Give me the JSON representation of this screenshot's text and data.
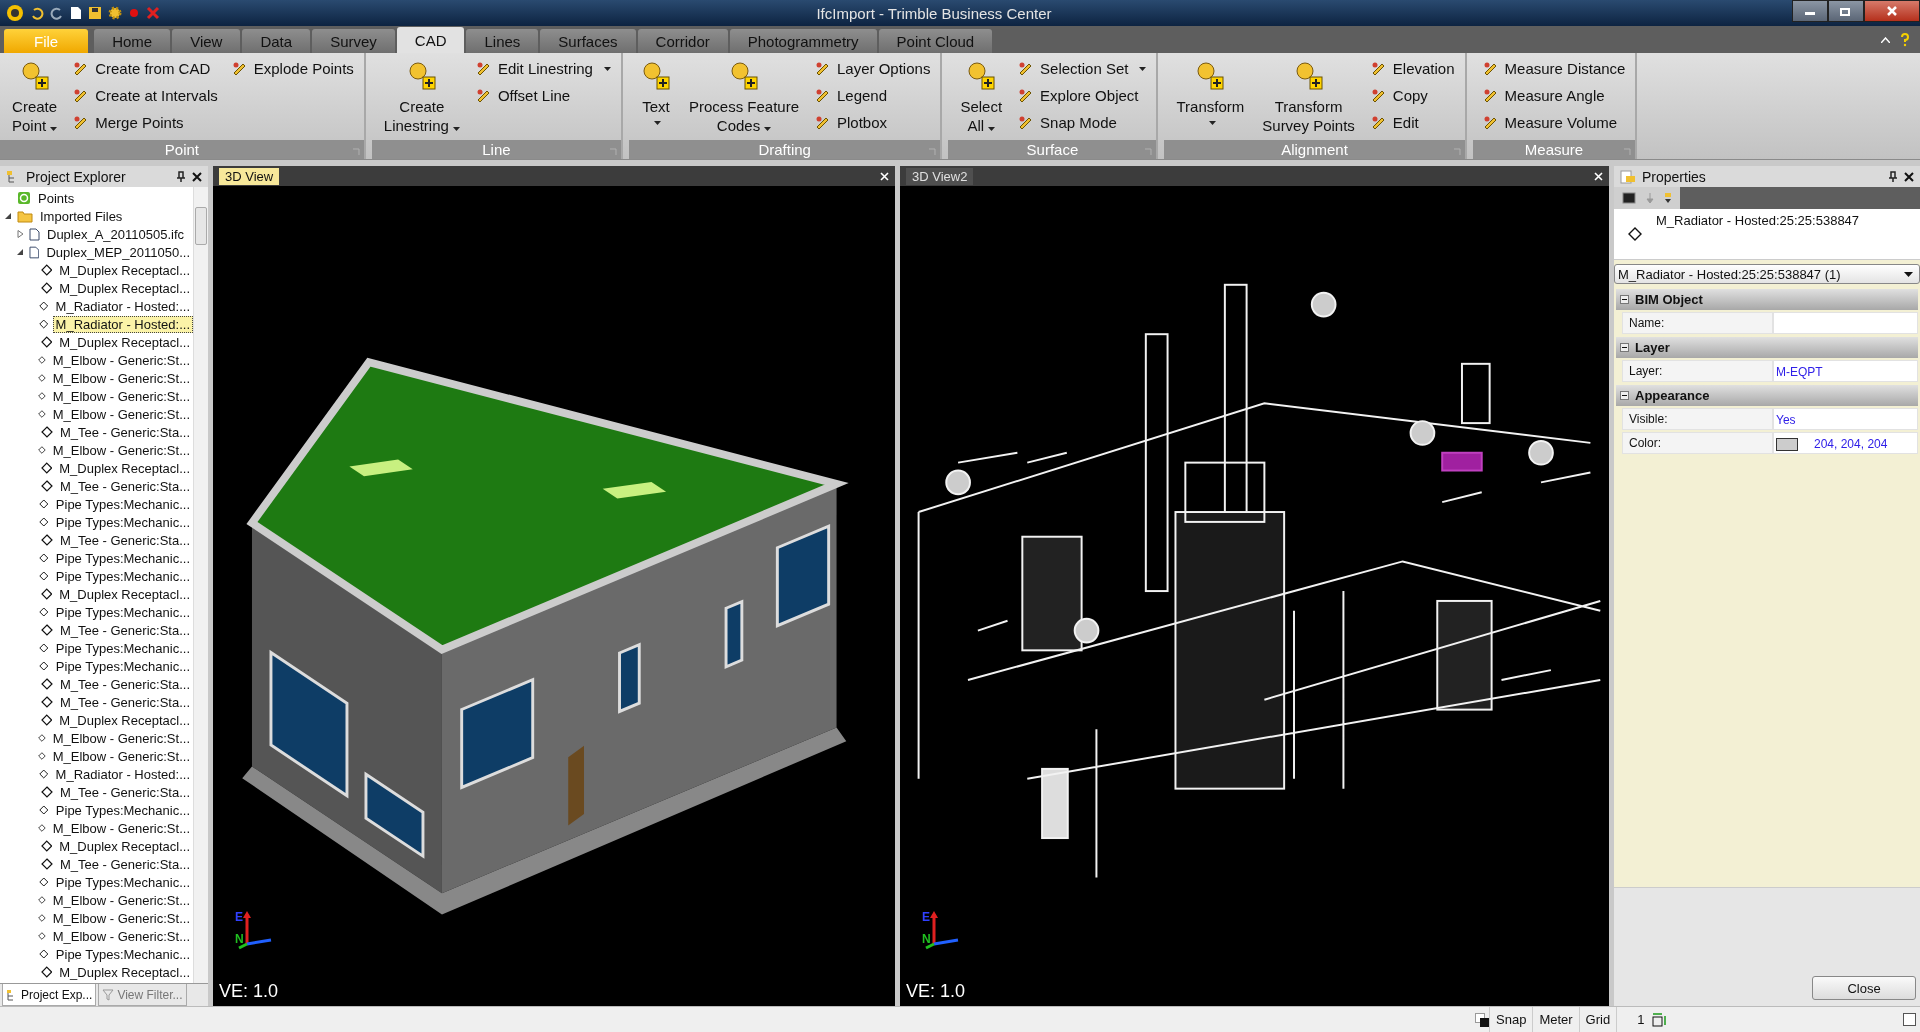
{
  "window": {
    "title": "IfcImport - Trimble Business Center"
  },
  "ribbon_tabs": [
    {
      "label": "File",
      "kind": "application",
      "selected": false
    },
    {
      "label": "Home",
      "kind": "tab",
      "selected": false
    },
    {
      "label": "View",
      "kind": "tab",
      "selected": false
    },
    {
      "label": "Data",
      "kind": "tab",
      "selected": false
    },
    {
      "label": "Survey",
      "kind": "tab",
      "selected": false
    },
    {
      "label": "CAD",
      "kind": "tab",
      "selected": true
    },
    {
      "label": "Lines",
      "kind": "tab",
      "selected": false
    },
    {
      "label": "Surfaces",
      "kind": "tab",
      "selected": false
    },
    {
      "label": "Corridor",
      "kind": "tab",
      "selected": false
    },
    {
      "label": "Photogrammetry",
      "kind": "tab",
      "selected": false
    },
    {
      "label": "Point Cloud",
      "kind": "tab",
      "selected": false
    }
  ],
  "ribbon_groups": [
    {
      "title": "Point",
      "items": [
        {
          "kind": "large",
          "lines": [
            "Create",
            "Point"
          ],
          "dropdown": true
        },
        {
          "kind": "small",
          "label": "Create from CAD",
          "dropdown": false
        },
        {
          "kind": "small",
          "label": "Create at Intervals",
          "dropdown": false
        },
        {
          "kind": "small",
          "label": "Merge Points",
          "dropdown": false
        },
        {
          "kind": "break"
        },
        {
          "kind": "small",
          "label": "Explode Points",
          "dropdown": false
        }
      ]
    },
    {
      "title": "Line",
      "items": [
        {
          "kind": "large",
          "lines": [
            "Create",
            "Linestring"
          ],
          "dropdown": true
        },
        {
          "kind": "small",
          "label": "Edit Linestring",
          "dropdown": true
        },
        {
          "kind": "small",
          "label": "Offset Line",
          "dropdown": false
        }
      ]
    },
    {
      "title": "Drafting",
      "items": [
        {
          "kind": "large",
          "lines": [
            "Text"
          ],
          "dropdown": true
        },
        {
          "kind": "large",
          "lines": [
            "Process Feature",
            "Codes"
          ],
          "dropdown": true
        },
        {
          "kind": "small",
          "label": "Layer Options",
          "dropdown": false
        },
        {
          "kind": "small",
          "label": "Legend",
          "dropdown": false
        },
        {
          "kind": "small",
          "label": "Plotbox",
          "dropdown": false
        }
      ]
    },
    {
      "title": "Surface",
      "items": [
        {
          "kind": "large",
          "lines": [
            "Select",
            "All"
          ],
          "dropdown": true
        },
        {
          "kind": "small",
          "label": "Selection Set",
          "dropdown": true
        },
        {
          "kind": "small",
          "label": "Explore Object",
          "dropdown": false
        },
        {
          "kind": "small",
          "label": "Snap Mode",
          "dropdown": false
        }
      ]
    },
    {
      "title": "Alignment",
      "items": [
        {
          "kind": "large",
          "lines": [
            "Transform"
          ],
          "dropdown": true
        },
        {
          "kind": "large",
          "lines": [
            "Transform",
            "Survey Points"
          ],
          "dropdown": false
        },
        {
          "kind": "small",
          "label": "Elevation",
          "dropdown": false
        },
        {
          "kind": "small",
          "label": "Copy",
          "dropdown": false
        },
        {
          "kind": "small",
          "label": "Edit",
          "dropdown": false
        }
      ]
    },
    {
      "title": "Measure",
      "items": [
        {
          "kind": "small",
          "label": "Measure Distance",
          "dropdown": false
        },
        {
          "kind": "small",
          "label": "Measure Angle",
          "dropdown": false
        },
        {
          "kind": "small",
          "label": "Measure Volume",
          "dropdown": false
        }
      ]
    }
  ],
  "project_explorer": {
    "title": "Project Explorer",
    "tree": [
      {
        "label": "Points",
        "kind": "points",
        "selected": false
      },
      {
        "label": "Imported Files",
        "kind": "folder",
        "selected": false,
        "expanded": true,
        "children": [
          {
            "label": "Duplex_A_20110505.ifc",
            "kind": "file",
            "selected": false,
            "expanded": false
          },
          {
            "label": "Duplex_MEP_2011050...",
            "kind": "file",
            "selected": false,
            "expanded": true,
            "children": [
              {
                "label": "M_Duplex  Receptacl...",
                "kind": "object",
                "selected": false
              },
              {
                "label": "M_Duplex  Receptacl...",
                "kind": "object",
                "selected": false
              },
              {
                "label": "M_Radiator - Hosted:...",
                "kind": "object",
                "selected": false
              },
              {
                "label": "M_Radiator - Hosted:...",
                "kind": "object",
                "selected": true
              },
              {
                "label": "M_Duplex  Receptacl...",
                "kind": "object",
                "selected": false
              },
              {
                "label": "M_Elbow - Generic:St...",
                "kind": "object",
                "selected": false
              },
              {
                "label": "M_Elbow - Generic:St...",
                "kind": "object",
                "selected": false
              },
              {
                "label": "M_Elbow - Generic:St...",
                "kind": "object",
                "selected": false
              },
              {
                "label": "M_Elbow - Generic:St...",
                "kind": "object",
                "selected": false
              },
              {
                "label": "M_Tee - Generic:Sta...",
                "kind": "object",
                "selected": false
              },
              {
                "label": "M_Elbow - Generic:St...",
                "kind": "object",
                "selected": false
              },
              {
                "label": "M_Duplex  Receptacl...",
                "kind": "object",
                "selected": false
              },
              {
                "label": "M_Tee - Generic:Sta...",
                "kind": "object",
                "selected": false
              },
              {
                "label": "Pipe Types:Mechanic...",
                "kind": "object",
                "selected": false
              },
              {
                "label": "Pipe Types:Mechanic...",
                "kind": "object",
                "selected": false
              },
              {
                "label": "M_Tee - Generic:Sta...",
                "kind": "object",
                "selected": false
              },
              {
                "label": "Pipe Types:Mechanic...",
                "kind": "object",
                "selected": false
              },
              {
                "label": "Pipe Types:Mechanic...",
                "kind": "object",
                "selected": false
              },
              {
                "label": "M_Duplex  Receptacl...",
                "kind": "object",
                "selected": false
              },
              {
                "label": "Pipe Types:Mechanic...",
                "kind": "object",
                "selected": false
              },
              {
                "label": "M_Tee - Generic:Sta...",
                "kind": "object",
                "selected": false
              },
              {
                "label": "Pipe Types:Mechanic...",
                "kind": "object",
                "selected": false
              },
              {
                "label": "Pipe Types:Mechanic...",
                "kind": "object",
                "selected": false
              },
              {
                "label": "M_Tee - Generic:Sta...",
                "kind": "object",
                "selected": false
              },
              {
                "label": "M_Tee - Generic:Sta...",
                "kind": "object",
                "selected": false
              },
              {
                "label": "M_Duplex  Receptacl...",
                "kind": "object",
                "selected": false
              },
              {
                "label": "M_Elbow - Generic:St...",
                "kind": "object",
                "selected": false
              },
              {
                "label": "M_Elbow - Generic:St...",
                "kind": "object",
                "selected": false
              },
              {
                "label": "M_Radiator - Hosted:...",
                "kind": "object",
                "selected": false
              },
              {
                "label": "M_Tee - Generic:Sta...",
                "kind": "object",
                "selected": false
              },
              {
                "label": "Pipe Types:Mechanic...",
                "kind": "object",
                "selected": false
              },
              {
                "label": "M_Elbow - Generic:St...",
                "kind": "object",
                "selected": false
              },
              {
                "label": "M_Duplex  Receptacl...",
                "kind": "object",
                "selected": false
              },
              {
                "label": "M_Tee - Generic:Sta...",
                "kind": "object",
                "selected": false
              },
              {
                "label": "Pipe Types:Mechanic...",
                "kind": "object",
                "selected": false
              },
              {
                "label": "M_Elbow - Generic:St...",
                "kind": "object",
                "selected": false
              },
              {
                "label": "M_Elbow - Generic:St...",
                "kind": "object",
                "selected": false
              },
              {
                "label": "M_Elbow - Generic:St...",
                "kind": "object",
                "selected": false
              },
              {
                "label": "Pipe Types:Mechanic...",
                "kind": "object",
                "selected": false
              },
              {
                "label": "M_Duplex  Receptacl...",
                "kind": "object",
                "selected": false
              }
            ]
          }
        ]
      }
    ],
    "bottom_tabs": [
      {
        "label": "Project Exp...",
        "selected": true
      },
      {
        "label": "View Filter...",
        "selected": false
      }
    ]
  },
  "views": [
    {
      "tab": "3D View",
      "selected": true,
      "kind": "building",
      "axis_labels": [
        "E",
        "N"
      ],
      "scale": "VE: 1.0"
    },
    {
      "tab": "3D View2",
      "selected": false,
      "kind": "mep",
      "axis_labels": [
        "E",
        "N"
      ],
      "scale": "VE: 1.0"
    }
  ],
  "properties": {
    "title": "Properties",
    "object_name": "M_Radiator - Hosted:25:25:538847",
    "selector": "M_Radiator - Hosted:25:25:538847 (1)",
    "sections": [
      {
        "title": "BIM Object",
        "expanded": true,
        "rows": [
          {
            "label": "Name:"
          }
        ]
      },
      {
        "title": "Layer",
        "expanded": true,
        "rows": [
          {
            "label": "Layer:",
            "value": "M-EQPT"
          }
        ]
      },
      {
        "title": "Appearance",
        "expanded": true,
        "rows": [
          {
            "label": "Visible:",
            "value": "Yes"
          },
          {
            "label": "Color:",
            "value": "204, 204, 204",
            "color": "#cccccc"
          }
        ]
      }
    ],
    "close_button": "Close"
  },
  "status_bar": {
    "items": [
      "Snap",
      "Meter",
      "Grid",
      "1"
    ],
    "checkbox_checked": false
  }
}
